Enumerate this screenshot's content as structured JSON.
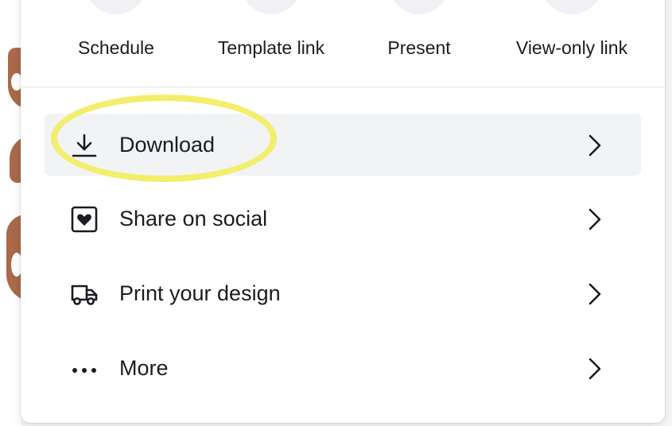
{
  "quick_actions": [
    {
      "label": "Schedule",
      "icon": "calendar-icon"
    },
    {
      "label": "Template link",
      "icon": "template-link-icon"
    },
    {
      "label": "Present",
      "icon": "present-icon"
    },
    {
      "label": "View-only link",
      "icon": "view-only-link-icon"
    }
  ],
  "menu": [
    {
      "label": "Download",
      "icon": "download-icon",
      "selected": true
    },
    {
      "label": "Share on social",
      "icon": "share-heart-icon",
      "selected": false
    },
    {
      "label": "Print your design",
      "icon": "truck-icon",
      "selected": false
    },
    {
      "label": "More",
      "icon": "more-dots-icon",
      "selected": false
    }
  ],
  "colors": {
    "panel_bg": "#ffffff",
    "selected_row_bg": "#f2f3f5",
    "text": "#1a1c20",
    "highlight": "#f3ee6b",
    "background_design": "#a9694a"
  }
}
